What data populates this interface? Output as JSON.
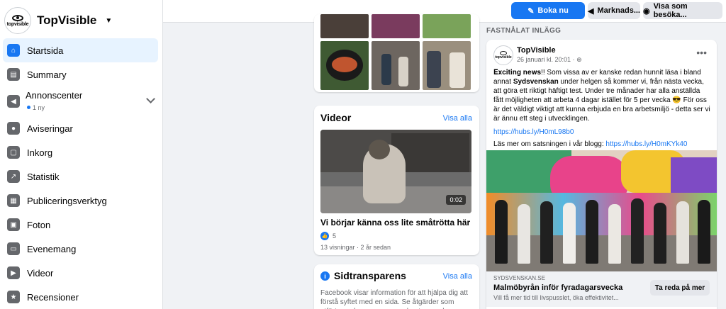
{
  "page": {
    "name": "TopVisible",
    "logo_text": "topvisible"
  },
  "sidebar": {
    "items": [
      {
        "label": "Startsida",
        "icon": "home-icon",
        "active": true
      },
      {
        "label": "Summary",
        "icon": "summary-icon"
      },
      {
        "label": "Annonscenter",
        "icon": "megaphone-icon",
        "sub": "1 ny"
      },
      {
        "label": "Aviseringar",
        "icon": "bell-icon"
      },
      {
        "label": "Inkorg",
        "icon": "inbox-icon"
      },
      {
        "label": "Statistik",
        "icon": "stats-icon"
      },
      {
        "label": "Publiceringsverktyg",
        "icon": "publishing-tools-icon"
      },
      {
        "label": "Foton",
        "icon": "photo-icon"
      },
      {
        "label": "Evenemang",
        "icon": "calendar-icon"
      },
      {
        "label": "Videor",
        "icon": "video-icon"
      },
      {
        "label": "Recensioner",
        "icon": "review-icon"
      }
    ]
  },
  "topbar": {
    "book_label": "Boka nu",
    "marketing_label": "Marknads...",
    "view_as_label": "Visa som besöka..."
  },
  "videos": {
    "title": "Videor",
    "see_all": "Visa alla",
    "duration": "0:02",
    "video_title": "Vi börjar känna oss lite småtrötta här ...",
    "likes": "5",
    "meta": "13 visningar · 2 år sedan"
  },
  "transparency": {
    "title": "Sidtransparens",
    "see_all": "Visa alla",
    "text": "Facebook visar information för att hjälpa dig att förstå syftet med en sida. Se åtgärder som utförts av de personer som hanterar och"
  },
  "pinned": {
    "heading": "FASTNÅLAT INLÄGG",
    "author": "TopVisible",
    "time": "26 januari kl. 20:01 ·",
    "body_intro": "𝐄𝐱𝐜𝐢𝐭𝐢𝐧𝐠 𝐧𝐞𝐰𝐬!! Som vissa av er kanske redan hunnit läsa i bland annat ",
    "body_bold": "Sydsvenskan",
    "body_rest": " under helgen så kommer vi, från nästa vecka, att göra ett riktigt häftigt test. Under tre månader har alla anställda fått möjligheten att arbeta 4 dagar istället för 5 per vecka 😎 För oss är det väldigt viktigt att kunna erbjuda en bra arbetsmiljö - detta ser vi är ännu ett steg i utvecklingen.",
    "link1": "https://hubs.ly/H0mL98b0",
    "more_prefix": "Läs mer om satsningen i vår blogg: ",
    "link2": "https://hubs.ly/H0mKYk40",
    "link_source": "SYDSVENSKAN.SE",
    "link_title": "Malmöbyrån inför fyradagarsvecka",
    "link_desc": "Vill få mer tid till livspusslet, öka effektivitet...",
    "link_button": "Ta reda på mer"
  }
}
